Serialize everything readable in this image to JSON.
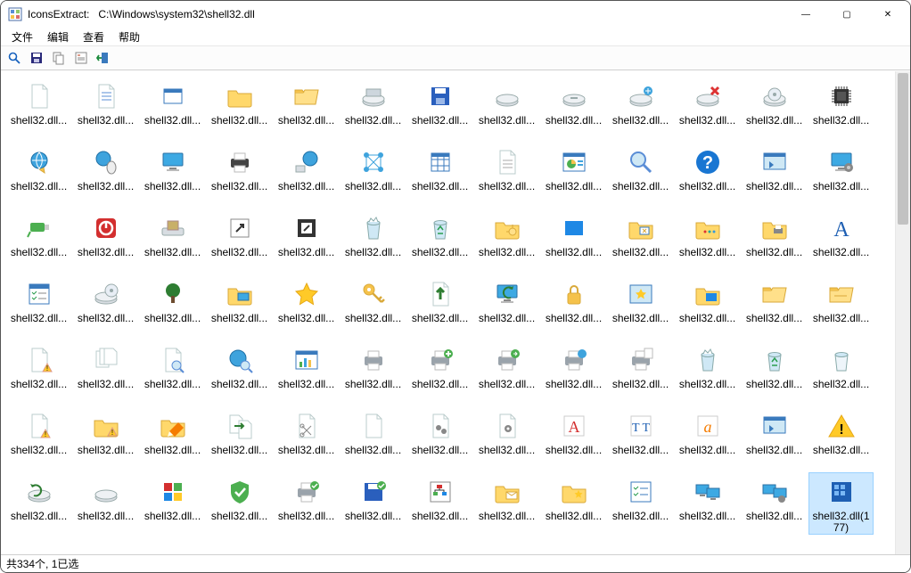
{
  "window": {
    "app_name": "IconsExtract:",
    "path": "C:\\Windows\\system32\\shell32.dll"
  },
  "sysbuttons": {
    "min": "—",
    "max": "▢",
    "close": "✕"
  },
  "menu": {
    "file": "文件",
    "edit": "编辑",
    "view": "查看",
    "help": "帮助"
  },
  "statusbar": {
    "text": "共334个, 1已选"
  },
  "default_label": "shell32.dll...",
  "selected_label": "shell32.dll(177)",
  "icons": [
    {
      "t": "page"
    },
    {
      "t": "doc-lines"
    },
    {
      "t": "window-small"
    },
    {
      "t": "folder-closed"
    },
    {
      "t": "folder-open"
    },
    {
      "t": "drive-top"
    },
    {
      "t": "floppy-blue"
    },
    {
      "t": "drive-flat"
    },
    {
      "t": "drive-flat2"
    },
    {
      "t": "drive-net"
    },
    {
      "t": "drive-x"
    },
    {
      "t": "disc-drive"
    },
    {
      "t": "chip"
    },
    {
      "t": "globe-arrow"
    },
    {
      "t": "globe-mouse"
    },
    {
      "t": "monitor"
    },
    {
      "t": "printer-dark"
    },
    {
      "t": "net-globe"
    },
    {
      "t": "net-nodes"
    },
    {
      "t": "grid-blue"
    },
    {
      "t": "page-lines"
    },
    {
      "t": "pie-window"
    },
    {
      "t": "magnifier"
    },
    {
      "t": "help-circle"
    },
    {
      "t": "window-run"
    },
    {
      "t": "monitor-gear"
    },
    {
      "t": "usb-green"
    },
    {
      "t": "power-red"
    },
    {
      "t": "dock"
    },
    {
      "t": "shortcut-link"
    },
    {
      "t": "shortcut-badge"
    },
    {
      "t": "bin-full"
    },
    {
      "t": "bin-recycle"
    },
    {
      "t": "folder-net"
    },
    {
      "t": "square-blue"
    },
    {
      "t": "folder-tool"
    },
    {
      "t": "folder-dots"
    },
    {
      "t": "folder-print"
    },
    {
      "t": "font-a"
    },
    {
      "t": "checklist"
    },
    {
      "t": "drive-cd"
    },
    {
      "t": "tree"
    },
    {
      "t": "folder-monitor"
    },
    {
      "t": "star"
    },
    {
      "t": "key-gold"
    },
    {
      "t": "arrow-up-green"
    },
    {
      "t": "refresh-monitor"
    },
    {
      "t": "lock"
    },
    {
      "t": "star-window"
    },
    {
      "t": "folder-blue"
    },
    {
      "t": "folder-open2"
    },
    {
      "t": "folder-open3"
    },
    {
      "t": "doc-warn"
    },
    {
      "t": "docs-stack"
    },
    {
      "t": "doc-search"
    },
    {
      "t": "globe-search"
    },
    {
      "t": "chart-window"
    },
    {
      "t": "printer-gray"
    },
    {
      "t": "printer-add"
    },
    {
      "t": "printer-go"
    },
    {
      "t": "printer-net"
    },
    {
      "t": "printer-file"
    },
    {
      "t": "bin-full2"
    },
    {
      "t": "bin-recycle2"
    },
    {
      "t": "bin-empty"
    },
    {
      "t": "doc-warn2"
    },
    {
      "t": "folder-warn"
    },
    {
      "t": "folder-edit"
    },
    {
      "t": "docs-move"
    },
    {
      "t": "doc-cut"
    },
    {
      "t": "doc-plain"
    },
    {
      "t": "doc-gears"
    },
    {
      "t": "doc-gear"
    },
    {
      "t": "font-a-red"
    },
    {
      "t": "font-tt"
    },
    {
      "t": "font-a-italic"
    },
    {
      "t": "run-window"
    },
    {
      "t": "warning"
    },
    {
      "t": "drive-refresh"
    },
    {
      "t": "drive-flat3"
    },
    {
      "t": "blocks"
    },
    {
      "t": "shield-check"
    },
    {
      "t": "printer-check"
    },
    {
      "t": "floppy-check"
    },
    {
      "t": "tree-diagram"
    },
    {
      "t": "folder-mail"
    },
    {
      "t": "folder-star"
    },
    {
      "t": "list-check"
    },
    {
      "t": "dual-monitor"
    },
    {
      "t": "dual-gear"
    },
    {
      "t": "grid-selected",
      "selected": true
    }
  ]
}
